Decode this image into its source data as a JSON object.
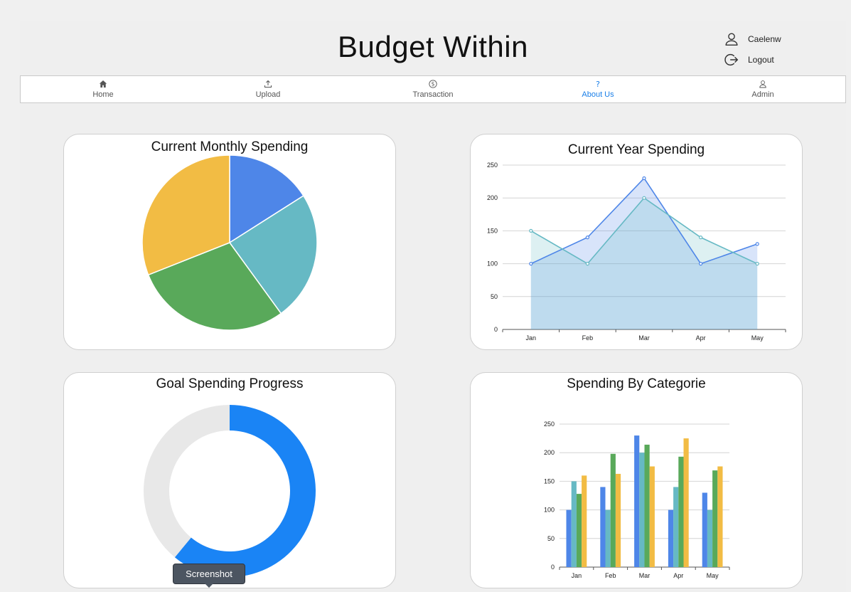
{
  "app": {
    "title": "Budget Within",
    "user": {
      "name": "Caelenw",
      "logout_label": "Logout"
    }
  },
  "nav": [
    {
      "label": "Home",
      "icon": "home-icon",
      "active": false
    },
    {
      "label": "Upload",
      "icon": "upload-icon",
      "active": false
    },
    {
      "label": "Transaction",
      "icon": "dollar-circle-icon",
      "active": false
    },
    {
      "label": "About Us",
      "icon": "question-icon",
      "active": true
    },
    {
      "label": "Admin",
      "icon": "user-icon",
      "active": false
    }
  ],
  "colors": {
    "blue": "#4e86e8",
    "teal": "#66b9c4",
    "green": "#59a95a",
    "yellow": "#f2bc44",
    "accent": "#1a7fe8",
    "track": "#e8e8e8"
  },
  "cards": {
    "monthly_title": "Current Monthly Spending",
    "year_title": "Current Year Spending",
    "goal_title": "Goal Spending Progress",
    "category_title": "Spending By Categorie"
  },
  "tooltip": "Screenshot",
  "chart_data": [
    {
      "type": "pie",
      "title": "Current Monthly Spending",
      "values": [
        16,
        24,
        29,
        31
      ],
      "colors": [
        "#4e86e8",
        "#66b9c4",
        "#59a95a",
        "#f2bc44"
      ]
    },
    {
      "type": "area",
      "title": "Current Year Spending",
      "categories": [
        "Jan",
        "Feb",
        "Mar",
        "Apr",
        "May"
      ],
      "series": [
        {
          "values": [
            100,
            140,
            230,
            100,
            130
          ],
          "color": "#4e86e8"
        },
        {
          "values": [
            150,
            100,
            200,
            140,
            100
          ],
          "color": "#66b9c4"
        }
      ],
      "ylim": [
        0,
        250
      ],
      "yticks": [
        0,
        50,
        100,
        150,
        200,
        250
      ],
      "grid": true
    },
    {
      "type": "pie",
      "title": "Goal Spending Progress",
      "values": [
        61,
        39
      ],
      "colors": [
        "#1a84f5",
        "#e8e8e8"
      ]
    },
    {
      "type": "bar",
      "title": "Spending By Categorie",
      "categories": [
        "Jan",
        "Feb",
        "Mar",
        "Apr",
        "May"
      ],
      "series": [
        {
          "values": [
            100,
            140,
            230,
            100,
            130
          ],
          "color": "#4e86e8"
        },
        {
          "values": [
            150,
            100,
            200,
            140,
            100
          ],
          "color": "#66b9c4"
        },
        {
          "values": [
            128,
            198,
            214,
            193,
            169
          ],
          "color": "#59a95a"
        },
        {
          "values": [
            160,
            163,
            176,
            225,
            176
          ],
          "color": "#f2bc44"
        }
      ],
      "ylim": [
        0,
        250
      ],
      "yticks": [
        0,
        50,
        100,
        150,
        200,
        250
      ],
      "grid": true
    }
  ]
}
